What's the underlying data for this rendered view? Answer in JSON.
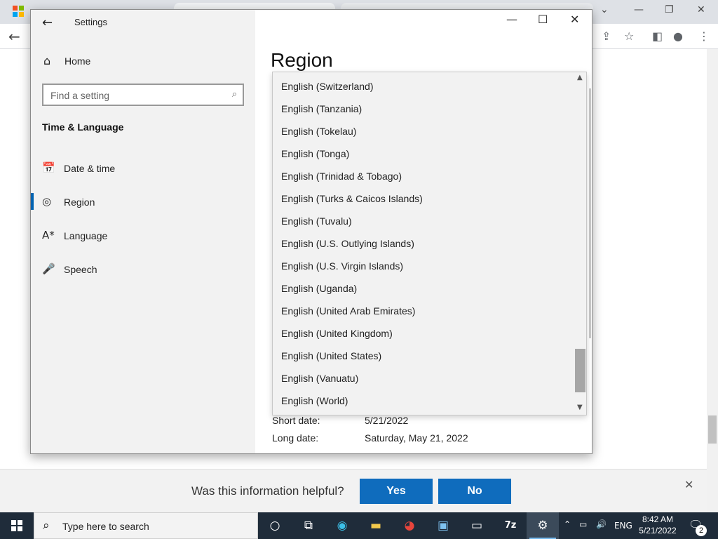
{
  "settings": {
    "window_title": "Settings",
    "home_label": "Home",
    "search_placeholder": "Find a setting",
    "section_title": "Time & Language",
    "nav_items": [
      {
        "label": "Date & time",
        "icon": "calendar-clock-icon"
      },
      {
        "label": "Region",
        "icon": "globe-icon",
        "selected": true
      },
      {
        "label": "Language",
        "icon": "language-icon"
      },
      {
        "label": "Speech",
        "icon": "microphone-icon"
      }
    ],
    "page_title": "Region",
    "region_list": [
      "English (Switzerland)",
      "English (Tanzania)",
      "English (Tokelau)",
      "English (Tonga)",
      "English (Trinidad & Tobago)",
      "English (Turks & Caicos Islands)",
      "English (Tuvalu)",
      "English (U.S. Outlying Islands)",
      "English (U.S. Virgin Islands)",
      "English (Uganda)",
      "English (United Arab Emirates)",
      "English (United Kingdom)",
      "English (United States)",
      "English (Vanuatu)",
      "English (World)"
    ],
    "details": {
      "short_date_label": "Short date:",
      "short_date_value": "5/21/2022",
      "long_date_label": "Long date:",
      "long_date_value": "Saturday, May 21, 2022"
    }
  },
  "feedback": {
    "question": "Was this information helpful?",
    "yes_label": "Yes",
    "no_label": "No"
  },
  "taskbar": {
    "search_placeholder": "Type here to search",
    "time": "8:42 AM",
    "date": "5/21/2022",
    "language": "ENG",
    "notification_count": "2",
    "apps": [
      "cortana-icon",
      "task-view-icon",
      "edge-icon",
      "file-explorer-icon",
      "chrome-icon",
      "control-panel-icon",
      "terminal-icon",
      "7zip-icon",
      "settings-icon"
    ]
  },
  "colors": {
    "accent": "#0063b1",
    "feedback_button": "#0f6cbd",
    "taskbar": "#1f2c3a"
  }
}
